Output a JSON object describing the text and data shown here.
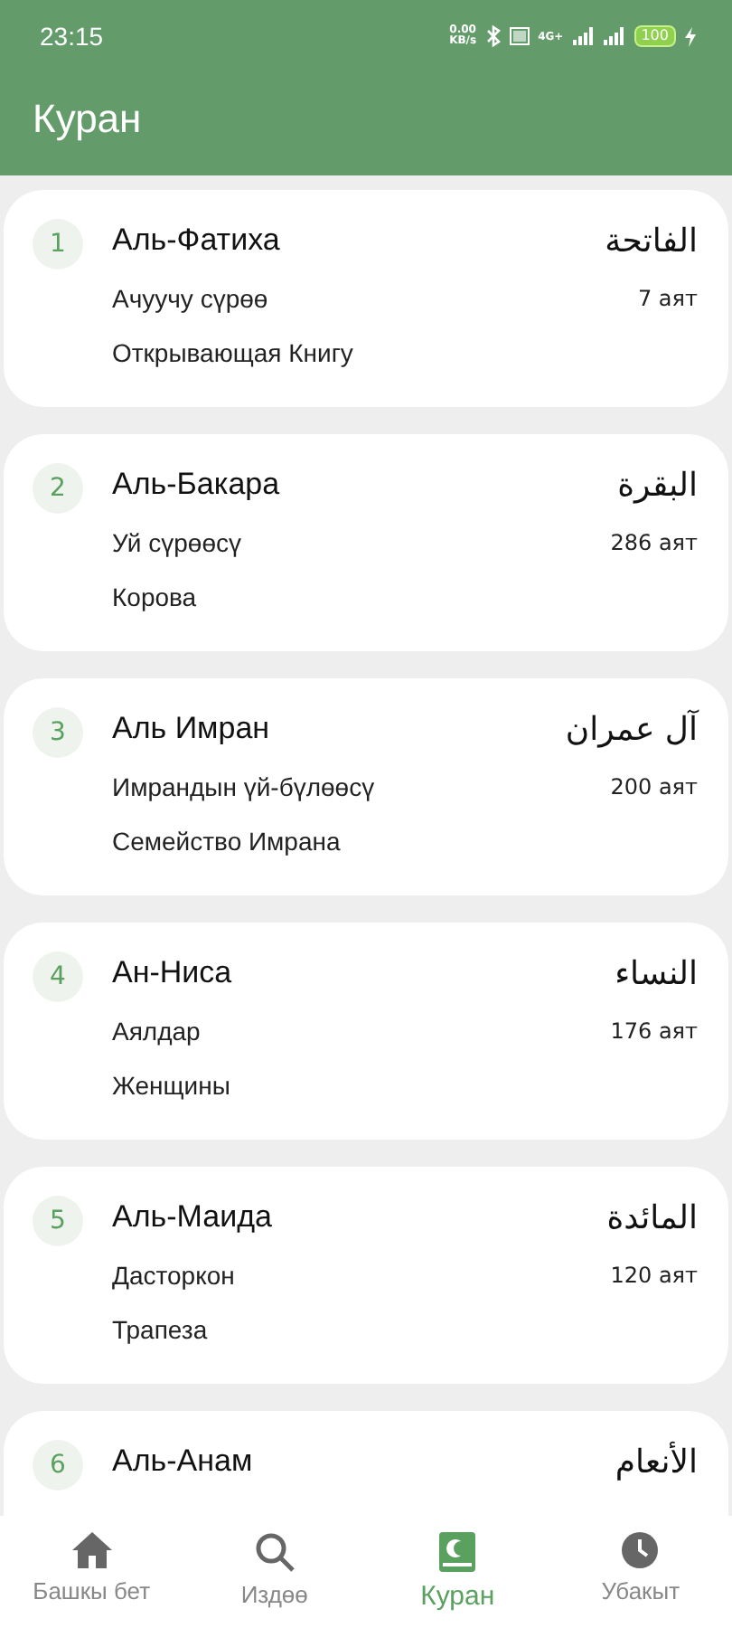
{
  "status_bar": {
    "time": "23:15",
    "speed_value": "0.00",
    "speed_unit": "KB/s",
    "network": "4G+",
    "battery": "100"
  },
  "app_bar": {
    "title": "Куран"
  },
  "surahs": [
    {
      "number": "1",
      "name": "Аль-Фатиха",
      "arabic": "الفاتحة",
      "kyrgyz": "Ачуучу сүрөө",
      "ayats": "7 аят",
      "russian": "Открывающая Книгу"
    },
    {
      "number": "2",
      "name": "Аль-Бакара",
      "arabic": "البقرة",
      "kyrgyz": "Уй сүрөөсү",
      "ayats": "286 аят",
      "russian": "Корова"
    },
    {
      "number": "3",
      "name": "Аль Имран",
      "arabic": "آل عمران",
      "kyrgyz": "Имрандын үй-бүлөөсү",
      "ayats": "200 аят",
      "russian": "Семейство Имрана"
    },
    {
      "number": "4",
      "name": "Ан-Ниса",
      "arabic": "النساء",
      "kyrgyz": "Аялдар",
      "ayats": "176 аят",
      "russian": "Женщины"
    },
    {
      "number": "5",
      "name": "Аль-Маида",
      "arabic": "المائدة",
      "kyrgyz": "Дасторкон",
      "ayats": "120 аят",
      "russian": "Трапеза"
    },
    {
      "number": "6",
      "name": "Аль-Анам",
      "arabic": "الأنعام"
    }
  ],
  "bottom_nav": [
    {
      "kind": "home",
      "label": "Башкы бет",
      "selected": false
    },
    {
      "kind": "search",
      "label": "Издөө",
      "selected": false
    },
    {
      "kind": "quran",
      "label": "Куран",
      "selected": true
    },
    {
      "kind": "clock",
      "label": "Убакыт",
      "selected": false
    }
  ]
}
